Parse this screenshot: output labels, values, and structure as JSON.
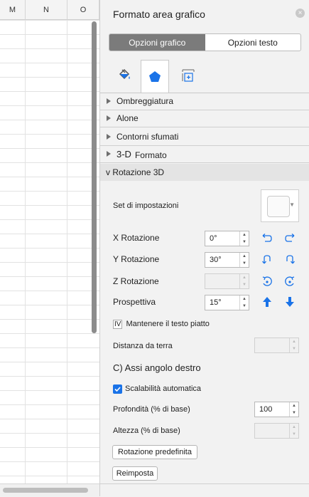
{
  "sheet": {
    "columns": [
      "M",
      "N",
      "O"
    ]
  },
  "panel": {
    "title": "Formato area grafico",
    "close_glyph": "×",
    "tabs": [
      "Opzioni grafico",
      "Opzioni testo"
    ],
    "icon_tabs": [
      "fill-bucket-icon",
      "pentagon-effects-icon",
      "size-properties-icon"
    ],
    "sections": [
      "Ombreggiatura",
      "Alone",
      "Contorni sfumati",
      "3-D",
      "Formato"
    ],
    "expanded_section": "v Rotazione 3D",
    "preset_label": "Set di impostazioni",
    "x_rotation": {
      "prefix": "X",
      "label": " Rotazione",
      "value": "0°"
    },
    "y_rotation": {
      "prefix": "Y",
      "label": " Rotazione",
      "value": "30°"
    },
    "z_rotation": {
      "prefix": "Z",
      "label": " Rotazione",
      "value": ""
    },
    "perspective": {
      "label": "Prospettiva",
      "value": "15°"
    },
    "keep_flat_prefix": "IV",
    "keep_flat": "Mantenere il testo piatto",
    "ground_distance": {
      "label": "Distanza da terra",
      "value": ""
    },
    "axes_title": "C) Assi angolo destro",
    "autoscale": "Scalabilità automatica",
    "depth": {
      "label": "Profondità (% di base)",
      "value": "100"
    },
    "height": {
      "label": "Altezza (% di base)",
      "value": ""
    },
    "default_rotation_button": "Rotazione predefinita",
    "reset_button": "Reimposta",
    "accent_color": "#1a73e8"
  }
}
